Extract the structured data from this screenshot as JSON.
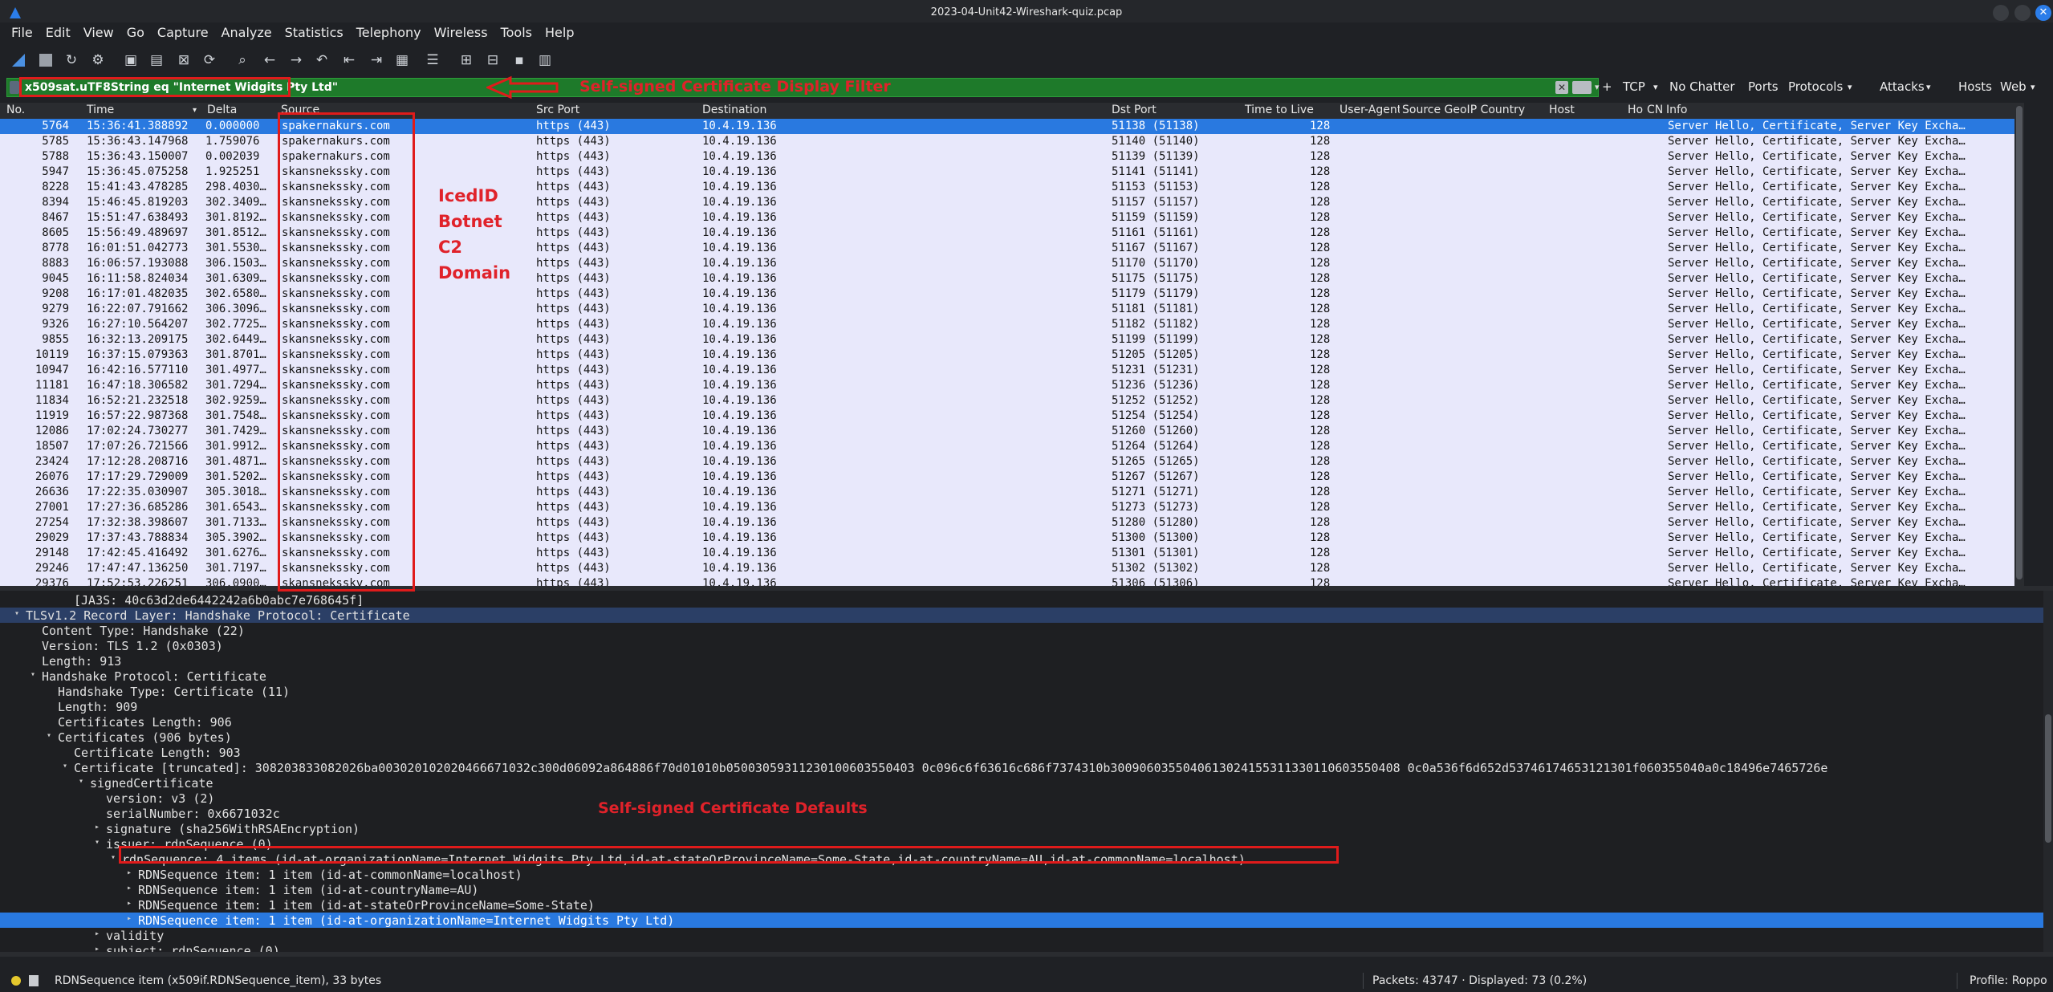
{
  "window": {
    "title": "2023-04-Unit42-Wireshark-quiz.pcap"
  },
  "menu": [
    "File",
    "Edit",
    "View",
    "Go",
    "Capture",
    "Analyze",
    "Statistics",
    "Telephony",
    "Wireless",
    "Tools",
    "Help"
  ],
  "toolbar_icons": [
    "shark-fin-start-icon",
    "stop-capture-icon",
    "restart-capture-icon",
    "capture-options-icon",
    "open-file-icon",
    "save-file-icon",
    "close-file-icon",
    "reload-file-icon",
    "find-packet-icon",
    "go-back-icon",
    "go-forward-icon",
    "go-to-packet-icon",
    "go-first-icon",
    "go-last-icon",
    "autoscroll-icon",
    "colorize-icon",
    "zoom-in-icon",
    "zoom-out-icon",
    "normal-size-icon",
    "resize-columns-icon"
  ],
  "filter": {
    "value": "x509sat.uTF8String eq \"Internet Widgits Pty Ltd\"",
    "clear_label": "✕",
    "buttons": {
      "plus": "+",
      "tcp": "TCP",
      "no_chatter": "No Chatter",
      "ports": "Ports",
      "protocols": "Protocols",
      "attacks": "Attacks",
      "hosts": "Hosts",
      "web": "Web"
    }
  },
  "columns": {
    "no": "No.",
    "time": "Time",
    "delta": "Delta",
    "source": "Source",
    "src_port": "Src Port",
    "destination": "Destination",
    "dst_port": "Dst Port",
    "ttl": "Time to Live",
    "user_agent": "User-Agent",
    "geoip": "Source GeoIP Country",
    "host": "Host",
    "ho": "Ho",
    "cn": "CN",
    "info": "Info"
  },
  "packets": [
    {
      "no": "5764",
      "time": "15:36:41.388892",
      "delta": "0.000000",
      "src": "spakernakurs.com",
      "sport": "https (443)",
      "dst": "10.4.19.136",
      "dport": "51138 (51138)",
      "ttl": "128",
      "info": "Server Hello, Certificate, Server Key Excha…"
    },
    {
      "no": "5785",
      "time": "15:36:43.147968",
      "delta": "1.759076",
      "src": "spakernakurs.com",
      "sport": "https (443)",
      "dst": "10.4.19.136",
      "dport": "51140 (51140)",
      "ttl": "128",
      "info": "Server Hello, Certificate, Server Key Excha…"
    },
    {
      "no": "5788",
      "time": "15:36:43.150007",
      "delta": "0.002039",
      "src": "spakernakurs.com",
      "sport": "https (443)",
      "dst": "10.4.19.136",
      "dport": "51139 (51139)",
      "ttl": "128",
      "info": "Server Hello, Certificate, Server Key Excha…"
    },
    {
      "no": "5947",
      "time": "15:36:45.075258",
      "delta": "1.925251",
      "src": "skansnekssky.com",
      "sport": "https (443)",
      "dst": "10.4.19.136",
      "dport": "51141 (51141)",
      "ttl": "128",
      "info": "Server Hello, Certificate, Server Key Excha…"
    },
    {
      "no": "8228",
      "time": "15:41:43.478285",
      "delta": "298.4030…",
      "src": "skansnekssky.com",
      "sport": "https (443)",
      "dst": "10.4.19.136",
      "dport": "51153 (51153)",
      "ttl": "128",
      "info": "Server Hello, Certificate, Server Key Excha…"
    },
    {
      "no": "8394",
      "time": "15:46:45.819203",
      "delta": "302.3409…",
      "src": "skansnekssky.com",
      "sport": "https (443)",
      "dst": "10.4.19.136",
      "dport": "51157 (51157)",
      "ttl": "128",
      "info": "Server Hello, Certificate, Server Key Excha…"
    },
    {
      "no": "8467",
      "time": "15:51:47.638493",
      "delta": "301.8192…",
      "src": "skansnekssky.com",
      "sport": "https (443)",
      "dst": "10.4.19.136",
      "dport": "51159 (51159)",
      "ttl": "128",
      "info": "Server Hello, Certificate, Server Key Excha…"
    },
    {
      "no": "8605",
      "time": "15:56:49.489697",
      "delta": "301.8512…",
      "src": "skansnekssky.com",
      "sport": "https (443)",
      "dst": "10.4.19.136",
      "dport": "51161 (51161)",
      "ttl": "128",
      "info": "Server Hello, Certificate, Server Key Excha…"
    },
    {
      "no": "8778",
      "time": "16:01:51.042773",
      "delta": "301.5530…",
      "src": "skansnekssky.com",
      "sport": "https (443)",
      "dst": "10.4.19.136",
      "dport": "51167 (51167)",
      "ttl": "128",
      "info": "Server Hello, Certificate, Server Key Excha…"
    },
    {
      "no": "8883",
      "time": "16:06:57.193088",
      "delta": "306.1503…",
      "src": "skansnekssky.com",
      "sport": "https (443)",
      "dst": "10.4.19.136",
      "dport": "51170 (51170)",
      "ttl": "128",
      "info": "Server Hello, Certificate, Server Key Excha…"
    },
    {
      "no": "9045",
      "time": "16:11:58.824034",
      "delta": "301.6309…",
      "src": "skansnekssky.com",
      "sport": "https (443)",
      "dst": "10.4.19.136",
      "dport": "51175 (51175)",
      "ttl": "128",
      "info": "Server Hello, Certificate, Server Key Excha…"
    },
    {
      "no": "9208",
      "time": "16:17:01.482035",
      "delta": "302.6580…",
      "src": "skansnekssky.com",
      "sport": "https (443)",
      "dst": "10.4.19.136",
      "dport": "51179 (51179)",
      "ttl": "128",
      "info": "Server Hello, Certificate, Server Key Excha…"
    },
    {
      "no": "9279",
      "time": "16:22:07.791662",
      "delta": "306.3096…",
      "src": "skansnekssky.com",
      "sport": "https (443)",
      "dst": "10.4.19.136",
      "dport": "51181 (51181)",
      "ttl": "128",
      "info": "Server Hello, Certificate, Server Key Excha…"
    },
    {
      "no": "9326",
      "time": "16:27:10.564207",
      "delta": "302.7725…",
      "src": "skansnekssky.com",
      "sport": "https (443)",
      "dst": "10.4.19.136",
      "dport": "51182 (51182)",
      "ttl": "128",
      "info": "Server Hello, Certificate, Server Key Excha…"
    },
    {
      "no": "9855",
      "time": "16:32:13.209175",
      "delta": "302.6449…",
      "src": "skansnekssky.com",
      "sport": "https (443)",
      "dst": "10.4.19.136",
      "dport": "51199 (51199)",
      "ttl": "128",
      "info": "Server Hello, Certificate, Server Key Excha…"
    },
    {
      "no": "10119",
      "time": "16:37:15.079363",
      "delta": "301.8701…",
      "src": "skansnekssky.com",
      "sport": "https (443)",
      "dst": "10.4.19.136",
      "dport": "51205 (51205)",
      "ttl": "128",
      "info": "Server Hello, Certificate, Server Key Excha…"
    },
    {
      "no": "10947",
      "time": "16:42:16.577110",
      "delta": "301.4977…",
      "src": "skansnekssky.com",
      "sport": "https (443)",
      "dst": "10.4.19.136",
      "dport": "51231 (51231)",
      "ttl": "128",
      "info": "Server Hello, Certificate, Server Key Excha…"
    },
    {
      "no": "11181",
      "time": "16:47:18.306582",
      "delta": "301.7294…",
      "src": "skansnekssky.com",
      "sport": "https (443)",
      "dst": "10.4.19.136",
      "dport": "51236 (51236)",
      "ttl": "128",
      "info": "Server Hello, Certificate, Server Key Excha…"
    },
    {
      "no": "11834",
      "time": "16:52:21.232518",
      "delta": "302.9259…",
      "src": "skansnekssky.com",
      "sport": "https (443)",
      "dst": "10.4.19.136",
      "dport": "51252 (51252)",
      "ttl": "128",
      "info": "Server Hello, Certificate, Server Key Excha…"
    },
    {
      "no": "11919",
      "time": "16:57:22.987368",
      "delta": "301.7548…",
      "src": "skansnekssky.com",
      "sport": "https (443)",
      "dst": "10.4.19.136",
      "dport": "51254 (51254)",
      "ttl": "128",
      "info": "Server Hello, Certificate, Server Key Excha…"
    },
    {
      "no": "12086",
      "time": "17:02:24.730277",
      "delta": "301.7429…",
      "src": "skansnekssky.com",
      "sport": "https (443)",
      "dst": "10.4.19.136",
      "dport": "51260 (51260)",
      "ttl": "128",
      "info": "Server Hello, Certificate, Server Key Excha…"
    },
    {
      "no": "18507",
      "time": "17:07:26.721566",
      "delta": "301.9912…",
      "src": "skansnekssky.com",
      "sport": "https (443)",
      "dst": "10.4.19.136",
      "dport": "51264 (51264)",
      "ttl": "128",
      "info": "Server Hello, Certificate, Server Key Excha…"
    },
    {
      "no": "23424",
      "time": "17:12:28.208716",
      "delta": "301.4871…",
      "src": "skansnekssky.com",
      "sport": "https (443)",
      "dst": "10.4.19.136",
      "dport": "51265 (51265)",
      "ttl": "128",
      "info": "Server Hello, Certificate, Server Key Excha…"
    },
    {
      "no": "26076",
      "time": "17:17:29.729009",
      "delta": "301.5202…",
      "src": "skansnekssky.com",
      "sport": "https (443)",
      "dst": "10.4.19.136",
      "dport": "51267 (51267)",
      "ttl": "128",
      "info": "Server Hello, Certificate, Server Key Excha…"
    },
    {
      "no": "26636",
      "time": "17:22:35.030907",
      "delta": "305.3018…",
      "src": "skansnekssky.com",
      "sport": "https (443)",
      "dst": "10.4.19.136",
      "dport": "51271 (51271)",
      "ttl": "128",
      "info": "Server Hello, Certificate, Server Key Excha…"
    },
    {
      "no": "27001",
      "time": "17:27:36.685286",
      "delta": "301.6543…",
      "src": "skansnekssky.com",
      "sport": "https (443)",
      "dst": "10.4.19.136",
      "dport": "51273 (51273)",
      "ttl": "128",
      "info": "Server Hello, Certificate, Server Key Excha…"
    },
    {
      "no": "27254",
      "time": "17:32:38.398607",
      "delta": "301.7133…",
      "src": "skansnekssky.com",
      "sport": "https (443)",
      "dst": "10.4.19.136",
      "dport": "51280 (51280)",
      "ttl": "128",
      "info": "Server Hello, Certificate, Server Key Excha…"
    },
    {
      "no": "29029",
      "time": "17:37:43.788834",
      "delta": "305.3902…",
      "src": "skansnekssky.com",
      "sport": "https (443)",
      "dst": "10.4.19.136",
      "dport": "51300 (51300)",
      "ttl": "128",
      "info": "Server Hello, Certificate, Server Key Excha…"
    },
    {
      "no": "29148",
      "time": "17:42:45.416492",
      "delta": "301.6276…",
      "src": "skansnekssky.com",
      "sport": "https (443)",
      "dst": "10.4.19.136",
      "dport": "51301 (51301)",
      "ttl": "128",
      "info": "Server Hello, Certificate, Server Key Excha…"
    },
    {
      "no": "29246",
      "time": "17:47:47.136250",
      "delta": "301.7197…",
      "src": "skansnekssky.com",
      "sport": "https (443)",
      "dst": "10.4.19.136",
      "dport": "51302 (51302)",
      "ttl": "128",
      "info": "Server Hello, Certificate, Server Key Excha…"
    },
    {
      "no": "29376",
      "time": "17:52:53.226251",
      "delta": "306.0900…",
      "src": "skansnekssky.com",
      "sport": "https (443)",
      "dst": "10.4.19.136",
      "dport": "51306 (51306)",
      "ttl": "128",
      "info": "Server Hello, Certificate, Server Key Excha…"
    }
  ],
  "details": [
    {
      "indent": 4,
      "arrow": "",
      "text": "[JA3S: 40c63d2de6442242a6b0abc7e768645f]"
    },
    {
      "indent": 1,
      "arrow": "▾",
      "text": "TLSv1.2 Record Layer: Handshake Protocol: Certificate",
      "selected_dim": true
    },
    {
      "indent": 2,
      "arrow": "",
      "text": "Content Type: Handshake (22)"
    },
    {
      "indent": 2,
      "arrow": "",
      "text": "Version: TLS 1.2 (0x0303)"
    },
    {
      "indent": 2,
      "arrow": "",
      "text": "Length: 913"
    },
    {
      "indent": 2,
      "arrow": "▾",
      "text": "Handshake Protocol: Certificate"
    },
    {
      "indent": 3,
      "arrow": "",
      "text": "Handshake Type: Certificate (11)"
    },
    {
      "indent": 3,
      "arrow": "",
      "text": "Length: 909"
    },
    {
      "indent": 3,
      "arrow": "",
      "text": "Certificates Length: 906"
    },
    {
      "indent": 3,
      "arrow": "▾",
      "text": "Certificates (906 bytes)"
    },
    {
      "indent": 4,
      "arrow": "",
      "text": "Certificate Length: 903"
    },
    {
      "indent": 4,
      "arrow": "▾",
      "text": "Certificate [truncated]: 308203833082026ba003020102020466671032c300d06092a864886f70d01010b05003059311230100603550403 0c096c6f63616c686f7374310b3009060355040613024155311330110603550408 0c0a536f6d652d53746174653121301f060355040a0c18496e7465726e"
    },
    {
      "indent": 5,
      "arrow": "▾",
      "text": "signedCertificate"
    },
    {
      "indent": 6,
      "arrow": "",
      "text": "version: v3 (2)"
    },
    {
      "indent": 6,
      "arrow": "",
      "text": "serialNumber: 0x6671032c"
    },
    {
      "indent": 6,
      "arrow": "▸",
      "text": "signature (sha256WithRSAEncryption)"
    },
    {
      "indent": 6,
      "arrow": "▾",
      "text": "issuer: rdnSequence (0)"
    },
    {
      "indent": 7,
      "arrow": "▾",
      "text": "rdnSequence: 4 items (id-at-organizationName=Internet Widgits Pty Ltd,id-at-stateOrProvinceName=Some-State,id-at-countryName=AU,id-at-commonName=localhost)"
    },
    {
      "indent": 8,
      "arrow": "▸",
      "text": "RDNSequence item: 1 item (id-at-commonName=localhost)"
    },
    {
      "indent": 8,
      "arrow": "▸",
      "text": "RDNSequence item: 1 item (id-at-countryName=AU)"
    },
    {
      "indent": 8,
      "arrow": "▸",
      "text": "RDNSequence item: 1 item (id-at-stateOrProvinceName=Some-State)"
    },
    {
      "indent": 8,
      "arrow": "▸",
      "text": "RDNSequence item: 1 item (id-at-organizationName=Internet Widgits Pty Ltd)",
      "selected": true
    },
    {
      "indent": 6,
      "arrow": "▸",
      "text": "validity"
    },
    {
      "indent": 6,
      "arrow": "▸",
      "text": "subject: rdnSequence (0)"
    }
  ],
  "status": {
    "field_info": "RDNSequence item (x509if.RDNSequence_item), 33 bytes",
    "packets": "Packets: 43747 · Displayed: 73 (0.2%)",
    "profile": "Profile: Roppo"
  },
  "annotations": {
    "filter_label": "Self-signed Certificate Display Filter",
    "c2_label": [
      "IcedID",
      "Botnet",
      "C2",
      "Domain"
    ],
    "defaults_label": "Self-signed Certificate Defaults"
  },
  "colors": {
    "annotation_red": "#e01b1b",
    "selection_blue": "#2979e0",
    "filter_green": "#1e7a2a",
    "packet_bg": "#e8e8fb"
  }
}
